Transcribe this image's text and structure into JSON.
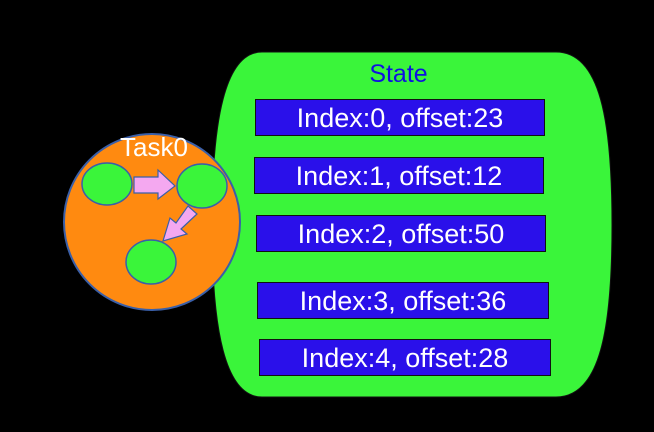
{
  "colors": {
    "background": "#000000",
    "state_fill": "#3af53a",
    "entry_fill": "#2a10ea",
    "entry_text": "#ffffff",
    "state_title_text": "#1010e0",
    "task_fill": "#ff8a10",
    "task_border": "#3a5fa8",
    "node_fill": "#3af53a",
    "arrow_fill": "#f4a8f0"
  },
  "task": {
    "label": "Task0"
  },
  "state": {
    "title": "State",
    "entries": [
      {
        "label": "Index:0, offset:23"
      },
      {
        "label": "Index:1, offset:12"
      },
      {
        "label": "Index:2, offset:50"
      },
      {
        "label": "Index:3, offset:36"
      },
      {
        "label": "Index:4, offset:28"
      }
    ]
  }
}
